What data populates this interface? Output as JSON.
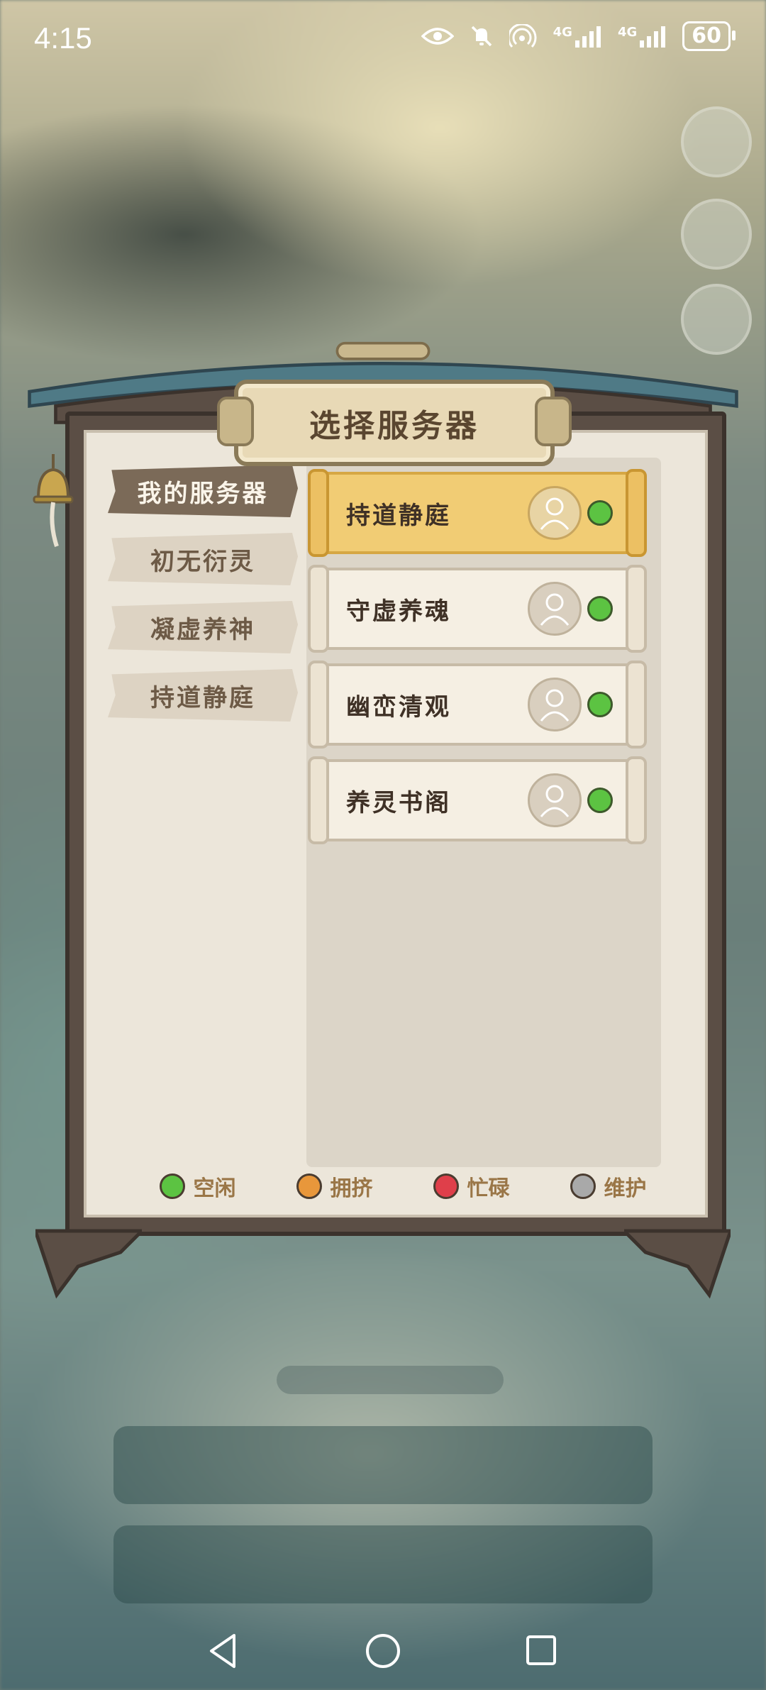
{
  "status_bar": {
    "time": "4:15",
    "network_1": "4G",
    "network_2": "4G",
    "battery": "60"
  },
  "dialog": {
    "title": "选择服务器",
    "tabs": [
      {
        "label": "我的服务器",
        "active": true
      },
      {
        "label": "初无衍灵",
        "active": false
      },
      {
        "label": "凝虚养神",
        "active": false
      },
      {
        "label": "持道静庭",
        "active": false
      }
    ],
    "servers": [
      {
        "name": "持道静庭",
        "status": "空闲",
        "selected": true
      },
      {
        "name": "守虚养魂",
        "status": "空闲",
        "selected": false
      },
      {
        "name": "幽峦清观",
        "status": "空闲",
        "selected": false
      },
      {
        "name": "养灵书阁",
        "status": "空闲",
        "selected": false
      }
    ],
    "legend": [
      {
        "label": "空闲",
        "color": "#5cc342"
      },
      {
        "label": "拥挤",
        "color": "#e8973b"
      },
      {
        "label": "忙碌",
        "color": "#df3f4a"
      },
      {
        "label": "维护",
        "color": "#a9a9a9"
      }
    ]
  },
  "colors": {
    "status_idle": "#5cc342",
    "accent_gold": "#f1cc74",
    "frame_dark": "#5b4e45"
  },
  "nav_bar": {
    "back_icon": "triangle-back-icon",
    "home_icon": "circle-home-icon",
    "recents_icon": "square-recents-icon"
  }
}
